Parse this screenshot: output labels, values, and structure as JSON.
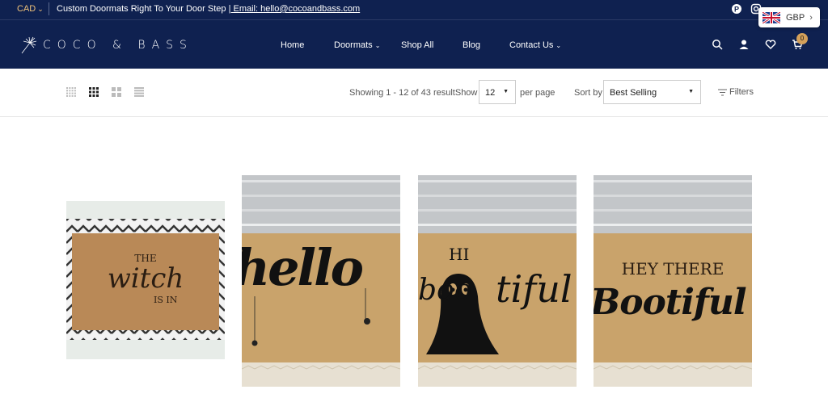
{
  "topbar": {
    "currency": "CAD",
    "message": "Custom Doormats Right To Your Door Step",
    "email_link": "| Email: hello@cocoandbass.com"
  },
  "brand": {
    "logo_text": "COCO & BASS"
  },
  "nav": {
    "home": "Home",
    "doormats": "Doormats",
    "shop_all": "Shop All",
    "blog": "Blog",
    "contact": "Contact Us",
    "cart_count": "0"
  },
  "currency_switcher": {
    "label": "GBP"
  },
  "toolbar": {
    "showing": "Showing 1 - 12 of 43 resultShow",
    "per_page_value": "12",
    "per_page_label": "per page",
    "sort_label": "Sort by",
    "sort_value": "Best Selling",
    "filters_label": "Filters"
  },
  "products": [
    {
      "line1": "THE",
      "line2": "witch",
      "line3": "IS IN"
    },
    {
      "line1": "hello"
    },
    {
      "line1": "HI",
      "line2": "boo",
      "line3": "tiful"
    },
    {
      "line1": "HEY THERE",
      "line2": "Bootiful"
    }
  ],
  "colors": {
    "navy": "#0f2150",
    "gold": "#f0c27a",
    "coir": "#c9a36b"
  }
}
